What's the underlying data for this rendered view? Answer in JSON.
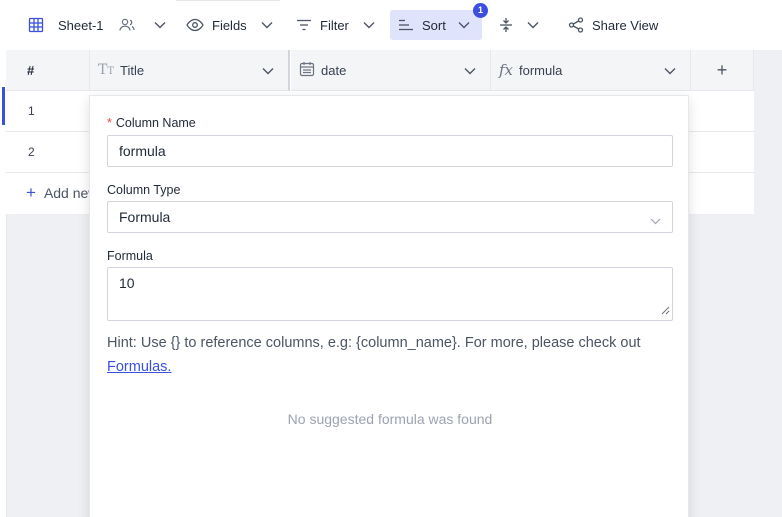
{
  "toolbar": {
    "sheet_label": "Sheet-1",
    "fields_label": "Fields",
    "filter_label": "Filter",
    "sort_label": "Sort",
    "sort_badge": "1",
    "share_label": "Share View"
  },
  "grid": {
    "row_number_header": "#",
    "columns": [
      {
        "label": "Title",
        "icon": "text-type-icon"
      },
      {
        "label": "date",
        "icon": "calendar-icon"
      },
      {
        "label": "formula",
        "icon": "fx-icon"
      }
    ],
    "add_column_label": "+",
    "rows": [
      "1",
      "2"
    ],
    "add_row_label": "Add new row"
  },
  "modal": {
    "required_mark": "*",
    "column_name_label": "Column Name",
    "column_name_value": "formula",
    "column_type_label": "Column Type",
    "column_type_value": "Formula",
    "formula_label": "Formula",
    "formula_value": "10",
    "hint_text": "Hint: Use {} to reference columns, e.g: {column_name}. For more, please check out ",
    "hint_link": "Formulas.",
    "empty_suggestions": "No suggested formula was found"
  },
  "colors": {
    "accent": "#3b50e0",
    "sort_active_bg": "#dfe3fb",
    "required": "#ef4444"
  }
}
